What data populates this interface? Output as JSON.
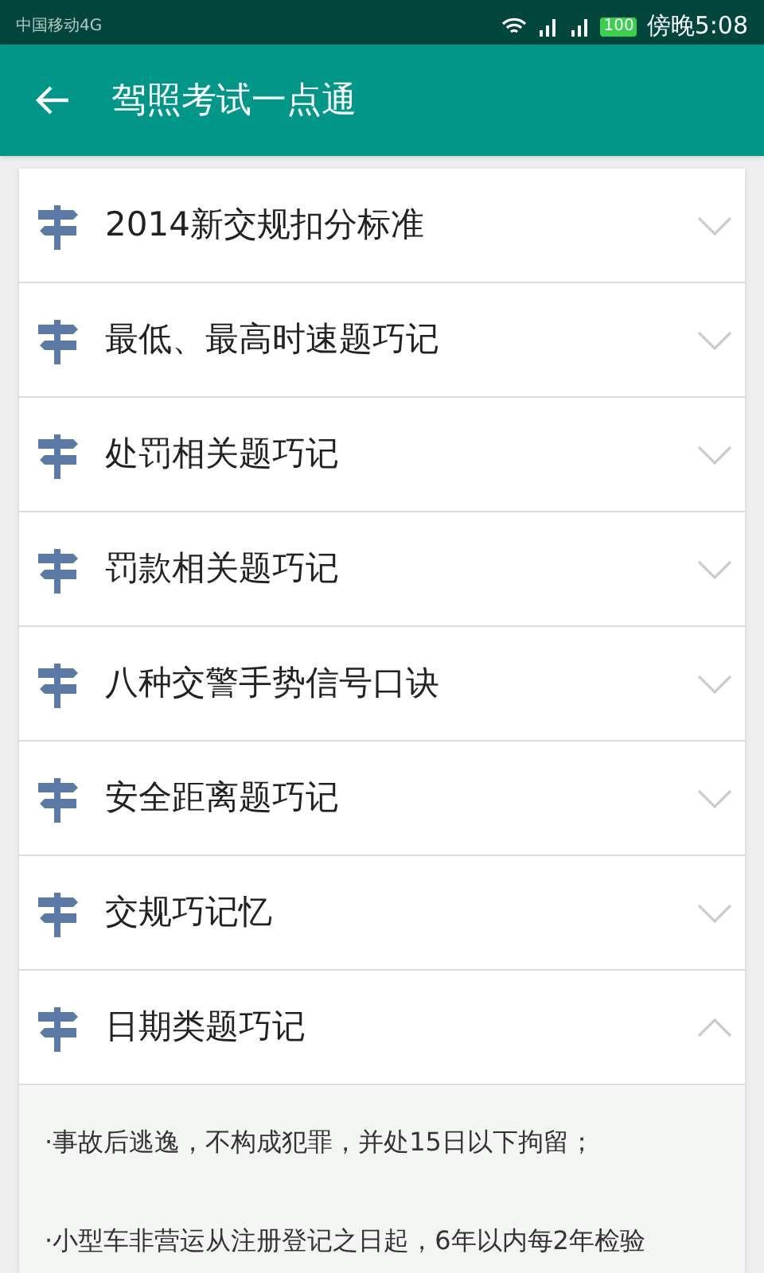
{
  "status_bar": {
    "carrier": "中国移动4G",
    "battery": "100",
    "time": "傍晚5:08"
  },
  "app_bar": {
    "title": "驾照考试一点通"
  },
  "sections": [
    {
      "title": "2014新交规扣分标准",
      "expanded": false
    },
    {
      "title": "最低、最高时速题巧记",
      "expanded": false
    },
    {
      "title": "处罚相关题巧记",
      "expanded": false
    },
    {
      "title": "罚款相关题巧记",
      "expanded": false
    },
    {
      "title": "八种交警手势信号口诀",
      "expanded": false
    },
    {
      "title": "安全距离题巧记",
      "expanded": false
    },
    {
      "title": "交规巧记忆",
      "expanded": false
    },
    {
      "title": "日期类题巧记",
      "expanded": true,
      "lines": [
        "·事故后逃逸，不构成犯罪，并处15日以下拘留；",
        "·小型车非营运从注册登记之日起，6年以内每2年检验"
      ]
    }
  ]
}
